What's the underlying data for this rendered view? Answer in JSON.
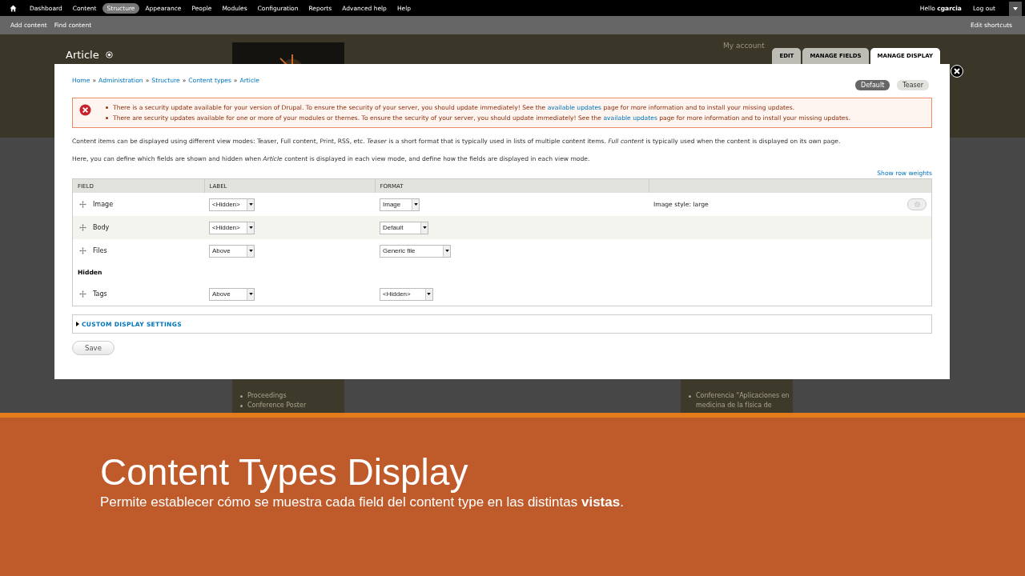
{
  "toolbar": {
    "items": [
      {
        "label": "Dashboard",
        "selected": false
      },
      {
        "label": "Content",
        "selected": false
      },
      {
        "label": "Structure",
        "selected": true
      },
      {
        "label": "Appearance",
        "selected": false
      },
      {
        "label": "People",
        "selected": false
      },
      {
        "label": "Modules",
        "selected": false
      },
      {
        "label": "Configuration",
        "selected": false
      },
      {
        "label": "Reports",
        "selected": false
      },
      {
        "label": "Advanced help",
        "selected": false
      },
      {
        "label": "Help",
        "selected": false
      }
    ],
    "greeting": "Hello",
    "user": "cgarcia",
    "logout": "Log out"
  },
  "shortcuts": {
    "items": [
      "Add content",
      "Find content"
    ],
    "edit": "Edit shortcuts"
  },
  "page": {
    "title": "Article",
    "account_link": "My account",
    "tabs": [
      {
        "label": "EDIT",
        "selected": false
      },
      {
        "label": "MANAGE FIELDS",
        "selected": false
      },
      {
        "label": "MANAGE DISPLAY",
        "selected": true
      }
    ],
    "sidebar_left": [
      "Proceedings",
      "Conference Poster"
    ],
    "sidebar_right": [
      "Conferencia \"Aplicaciones en medicina de la física de"
    ]
  },
  "modal": {
    "breadcrumb_separator": "»",
    "breadcrumb": [
      "Home",
      "Administration",
      "Structure",
      "Content types",
      "Article"
    ],
    "view_modes": [
      {
        "label": "Default",
        "selected": true
      },
      {
        "label": "Teaser",
        "selected": false
      }
    ],
    "messages": [
      {
        "before": "There is a security update available for your version of Drupal. To ensure the security of your server, you should update immediately! See the",
        "link": "available updates",
        "after": "page for more information and to install your missing updates."
      },
      {
        "before": "There are security updates available for one or more of your modules or themes. To ensure the security of your server, you should update immediately! See the",
        "link": "available updates",
        "after": "page for more information and to install your missing updates."
      }
    ],
    "paragraphs": [
      "Content items can be displayed using different view modes: Teaser, Full content, Print, RSS, etc. *Teaser* is a short format that is typically used in lists of multiple content items. *Full content* is typically used when the content is displayed on its own page.",
      "Here, you can define which fields are shown and hidden when *Article* content is displayed in each view mode, and define how the fields are displayed in each view mode."
    ],
    "row_weights_link": "Show row weights",
    "table": {
      "columns": [
        "FIELD",
        "LABEL",
        "FORMAT"
      ],
      "rows": [
        {
          "kind": "field",
          "name": "Image",
          "label": "<Hidden>",
          "format": "Image",
          "summary": "Image style: large",
          "settings": true
        },
        {
          "kind": "field",
          "name": "Body",
          "label": "<Hidden>",
          "format": "Default",
          "settings": false
        },
        {
          "kind": "field",
          "name": "Files",
          "label": "Above",
          "format": "Generic file",
          "settings": false
        },
        {
          "kind": "region",
          "name": "Hidden"
        },
        {
          "kind": "field",
          "name": "Tags",
          "label": "Above",
          "format": "<Hidden>",
          "settings": false
        }
      ]
    },
    "custom_settings": {
      "label": "CUSTOM DISPLAY SETTINGS",
      "expanded": false
    },
    "save": "Save"
  },
  "slide": {
    "title": "Content Types Display",
    "subtitle": "Permite establecer cómo se muestra cada field del content type en las distintas **vistas**."
  }
}
